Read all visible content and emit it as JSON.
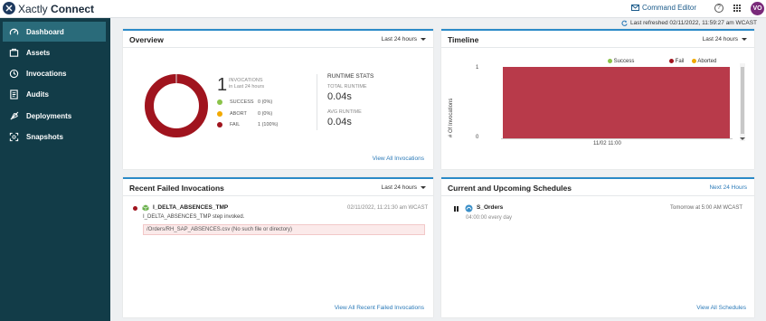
{
  "app": {
    "brand_light": "Xactly",
    "brand_bold": "Connect",
    "command_editor": "Command Editor",
    "help": "?",
    "avatar": "VO",
    "last_refreshed": "Last refreshed 02/11/2022, 11:59:27 am WCAST"
  },
  "sidebar": {
    "items": [
      {
        "label": "Dashboard",
        "icon": "dashboard-icon"
      },
      {
        "label": "Assets",
        "icon": "assets-icon"
      },
      {
        "label": "Invocations",
        "icon": "invocations-icon"
      },
      {
        "label": "Audits",
        "icon": "audits-icon"
      },
      {
        "label": "Deployments",
        "icon": "rocket-icon"
      },
      {
        "label": "Snapshots",
        "icon": "snapshots-icon"
      }
    ]
  },
  "overview": {
    "title": "Overview",
    "range": "Last 24 hours",
    "count": "1",
    "invocations_label": "INVOCATIONS",
    "invocations_sub": "in Last 24 hours",
    "success_label": "SUCCESS",
    "success_value": "0 (0%)",
    "abort_label": "ABORT",
    "abort_value": "0 (0%)",
    "fail_label": "FAIL",
    "fail_value": "1 (100%)",
    "runtime_title": "RUNTIME STATS",
    "total_label": "TOTAL RUNTIME",
    "total_value": "0.04s",
    "avg_label": "AVG RUNTIME",
    "avg_value": "0.04s",
    "view_all": "View All Invocations",
    "colors": {
      "success": "#8bc34a",
      "abort": "#f2a900",
      "fail": "#a0141e"
    }
  },
  "timeline": {
    "title": "Timeline",
    "range": "Last 24 hours",
    "legend": [
      "Success",
      "Fail",
      "Aborted"
    ],
    "ylabel": "# Of Invocations",
    "yticks": [
      "1",
      "0"
    ],
    "xtick": "11/02 11:00"
  },
  "chart_data": {
    "type": "bar",
    "categories": [
      "11/02 11:00"
    ],
    "series": [
      {
        "name": "Success",
        "values": [
          0
        ]
      },
      {
        "name": "Fail",
        "values": [
          1
        ]
      },
      {
        "name": "Aborted",
        "values": [
          0
        ]
      }
    ],
    "ylim": [
      0,
      1
    ],
    "ylabel": "# Of Invocations",
    "legend": "top-right"
  },
  "failed": {
    "title": "Recent Failed Invocations",
    "range": "Last 24 hours",
    "name": "I_DELTA_ABSENCES_TMP",
    "time": "02/11/2022, 11:21:30 am WCAST",
    "message": "I_DELTA_ABSENCES_TMP step invoked.",
    "error": "/Orders/RH_SAP_ABSENCES.csv (No such file or directory)",
    "view_all": "View All Recent Failed Invocations"
  },
  "schedules": {
    "title": "Current and Upcoming Schedules",
    "range": "Next 24 Hours",
    "name": "S_Orders",
    "when": "Tomorrow at 5:00 AM WCAST",
    "recurrence": "04:00:00 every day",
    "view_all": "View All Schedules"
  }
}
